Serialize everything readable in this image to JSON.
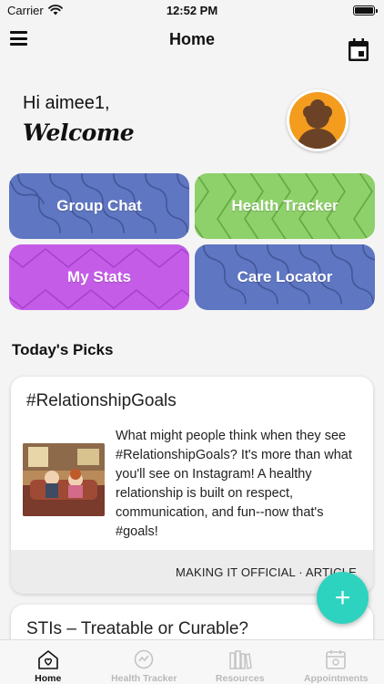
{
  "status_bar": {
    "carrier": "Carrier",
    "time": "12:52 PM",
    "icons": [
      "wifi-icon",
      "battery-icon"
    ]
  },
  "nav": {
    "title": "Home",
    "icons": [
      "menu-icon",
      "calendar-icon"
    ]
  },
  "greeting": {
    "hi": "Hi aimee1,",
    "welcome": "Welcome"
  },
  "tiles": [
    {
      "label": "Group Chat",
      "color": "#5f76c2"
    },
    {
      "label": "Health Tracker",
      "color": "#8ed06a"
    },
    {
      "label": "My Stats",
      "color": "#c55ce8"
    },
    {
      "label": "Care Locator",
      "color": "#5f76c2"
    }
  ],
  "picks": {
    "title": "Today's Picks",
    "cards": [
      {
        "title": "#RelationshipGoals",
        "body": "What might people think when they see #RelationshipGoals? It's more than what you'll see on Instagram! A healthy relationship is built on respect, communication, and fun--now that's #goals!",
        "footer": "MAKING IT OFFICIAL · ARTICLE"
      },
      {
        "title": "STIs – Treatable or Curable?"
      }
    ]
  },
  "fab": {
    "label": "+",
    "color": "#2ed3c0"
  },
  "tab_bar": {
    "tabs": [
      {
        "label": "Home",
        "icon": "home-heart-icon",
        "active": true
      },
      {
        "label": "Health Tracker",
        "icon": "health-tracker-icon",
        "active": false
      },
      {
        "label": "Resources",
        "icon": "books-icon",
        "active": false
      },
      {
        "label": "Appointments",
        "icon": "appointments-icon",
        "active": false
      }
    ]
  }
}
